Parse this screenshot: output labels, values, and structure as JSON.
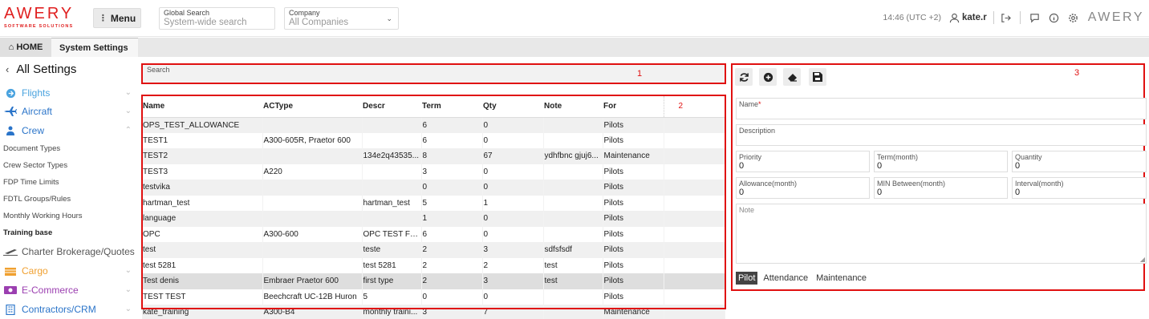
{
  "header": {
    "logo_text": "AWERY",
    "logo_sub": "SOFTWARE SOLUTIONS",
    "menu_label": "Menu",
    "global_search_label": "Global Search",
    "global_search_placeholder": "System-wide search",
    "company_label": "Company",
    "company_value": "All Companies",
    "time": "14:46 (UTC +2)",
    "user": "kate.r",
    "brand_right": "AWERY"
  },
  "tabs": [
    {
      "label": "HOME",
      "icon": "home-icon"
    },
    {
      "label": "System Settings"
    }
  ],
  "sidebar": {
    "title": "All Settings",
    "items": [
      {
        "label": "Flights",
        "icon": "flights-icon",
        "color": "#4aa3df"
      },
      {
        "label": "Aircraft",
        "icon": "plane-icon",
        "color": "#2a74c9"
      },
      {
        "label": "Crew",
        "icon": "crew-icon",
        "color": "#2a74c9"
      },
      {
        "label": "Charter Brokerage/Quotes",
        "icon": "charter-icon",
        "color": "#555555"
      },
      {
        "label": "Cargo",
        "icon": "cargo-icon",
        "color": "#f0a030"
      },
      {
        "label": "E-Commerce",
        "icon": "ecommerce-icon",
        "color": "#9b3fb0"
      },
      {
        "label": "Contractors/CRM",
        "icon": "crm-icon",
        "color": "#2a74c9"
      }
    ],
    "crew_sub": [
      "Document Types",
      "Crew Sector Types",
      "FDP Time Limits",
      "FDTL Groups/Rules",
      "Monthly Working Hours",
      "Training base"
    ]
  },
  "search": {
    "label": "Search"
  },
  "markers": [
    "1",
    "2",
    "3"
  ],
  "grid": {
    "columns": [
      "Name",
      "ACType",
      "Descr",
      "Term",
      "Qty",
      "Note",
      "For"
    ],
    "rows": [
      [
        "OPS_TEST_ALLOWANCE",
        "",
        "",
        "6",
        "0",
        "",
        "Pilots"
      ],
      [
        "TEST1",
        "A300-605R, Praetor 600",
        "",
        "6",
        "0",
        "",
        "Pilots"
      ],
      [
        "TEST2",
        "",
        "134e2q43535...",
        "8",
        "67",
        "ydhfbnc gjuj6...",
        "Maintenance"
      ],
      [
        "TEST3",
        "A220",
        "",
        "3",
        "0",
        "",
        "Pilots"
      ],
      [
        "testvika",
        "",
        "",
        "0",
        "0",
        "",
        "Pilots"
      ],
      [
        "hartman_test",
        "",
        "hartman_test",
        "5",
        "1",
        "",
        "Pilots"
      ],
      [
        "language",
        "",
        "",
        "1",
        "0",
        "",
        "Pilots"
      ],
      [
        "OPC",
        "A300-600",
        "OPC TEST FO...",
        "6",
        "0",
        "",
        "Pilots"
      ],
      [
        "test",
        "",
        "teste",
        "2",
        "3",
        "sdfsfsdf",
        "Pilots"
      ],
      [
        "test 5281",
        "",
        "test 5281",
        "2",
        "2",
        "test",
        "Pilots"
      ],
      [
        "Test denis",
        "Embraer Praetor 600",
        "first type",
        "2",
        "3",
        "test",
        "Pilots"
      ],
      [
        "TEST TEST",
        "Beechcraft UC-12B Huron",
        "5",
        "0",
        "0",
        "",
        "Pilots"
      ],
      [
        "kate_training",
        "A300-B4",
        "monthly traini...",
        "3",
        "7",
        "",
        "Maintenance"
      ]
    ]
  },
  "edit": {
    "name_label": "Name",
    "name_required": "*",
    "description_label": "Description",
    "priority_label": "Priority",
    "priority_value": "0",
    "term_label": "Term(month)",
    "term_value": "0",
    "quantity_label": "Quantity",
    "quantity_value": "0",
    "allowance_label": "Allowance(month)",
    "allowance_value": "0",
    "min_between_label": "MIN Between(month)",
    "min_between_value": "0",
    "interval_label": "Interval(month)",
    "interval_value": "0",
    "note_label": "Note",
    "chips": [
      "Pilot",
      "Attendance",
      "Maintenance"
    ]
  },
  "colors": {
    "accent_red": "#e01010",
    "brand_red": "#e02020"
  }
}
